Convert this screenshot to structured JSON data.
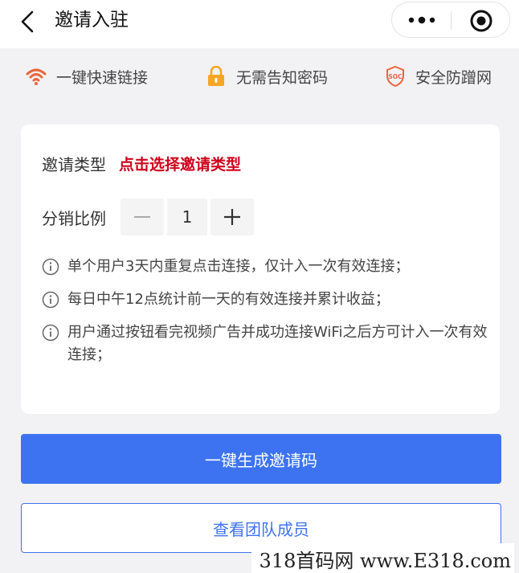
{
  "header": {
    "title": "邀请入驻",
    "back_icon": "chevron-left-icon",
    "more_icon": "more-dots-icon",
    "close_icon": "target-close-icon"
  },
  "features": [
    {
      "icon": "wifi-icon",
      "label": "一键快速链接",
      "color": "#e8663c"
    },
    {
      "icon": "lock-icon",
      "label": "无需告知密码",
      "color": "#f5a623"
    },
    {
      "icon": "soc-shield-icon",
      "label": "安全防蹭网",
      "color": "#e8663c"
    }
  ],
  "form": {
    "type_label": "邀请类型",
    "type_value": "点击选择邀请类型",
    "ratio_label": "分销比例",
    "ratio_value": "1"
  },
  "notes": [
    "单个用户3天内重复点击连接，仅计入一次有效连接；",
    "每日中午12点统计前一天的有效连接并累计收益；",
    "用户通过按钮看完视频广告并成功连接WiFi之后方可计入一次有效连接；"
  ],
  "actions": {
    "generate_label": "一键生成邀请码",
    "team_label": "查看团队成员"
  },
  "colors": {
    "accent": "#3d73f0",
    "warning_text": "#d0021b",
    "background": "#f2f2f4"
  },
  "watermark": "318首码网 www.E318.com"
}
